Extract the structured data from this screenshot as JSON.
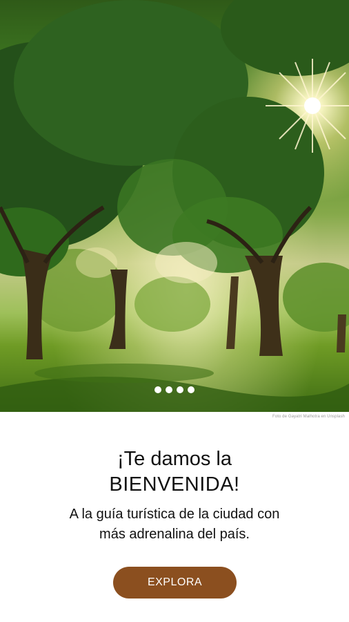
{
  "hero": {
    "photo_credit": "Foto de Gayatri Malhotra en Unsplash",
    "carousel_pages": 4
  },
  "welcome": {
    "title_line1": "¡Te damos la",
    "title_line2": "BIENVENIDA!",
    "subtitle_line1": "A la guía turística de la ciudad con",
    "subtitle_line2": "más adrenalina del país."
  },
  "actions": {
    "explore_label": "EXPLORA"
  },
  "colors": {
    "accent": "#8b4f1f",
    "text": "#111111",
    "background": "#ffffff"
  }
}
